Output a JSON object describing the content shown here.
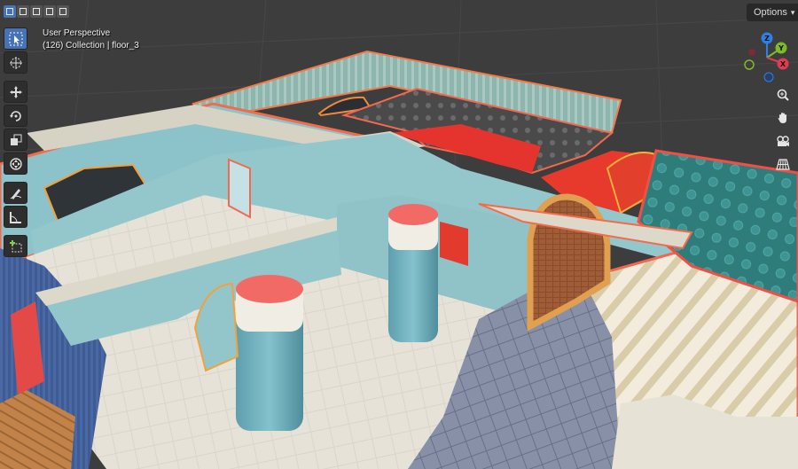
{
  "viewport": {
    "view_name": "User Perspective",
    "collection_info": "(126) Collection | floor_3"
  },
  "header": {
    "options_label": "Options",
    "select_modes": [
      "select-new",
      "select-extend",
      "select-subtract",
      "select-invert",
      "select-intersect"
    ]
  },
  "toolbar": {
    "tools": [
      "select-box",
      "cursor",
      "move",
      "rotate",
      "scale",
      "transform",
      "annotate",
      "measure",
      "add-cube"
    ]
  },
  "gizmo": {
    "axes": [
      {
        "label": "Z",
        "color": "#2f7fe8"
      },
      {
        "label": "Y",
        "color": "#7dbb27"
      },
      {
        "label": "X",
        "color": "#e23a52"
      }
    ]
  },
  "navigation": {
    "buttons": [
      "zoom",
      "pan",
      "camera",
      "ortho-grid"
    ]
  },
  "colors": {
    "selection_outline": "#f68a3a",
    "accent": "#4772b3",
    "background": "#3d3d3d"
  }
}
